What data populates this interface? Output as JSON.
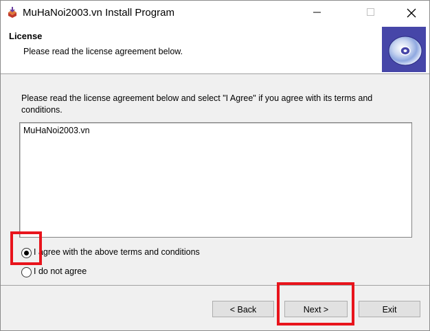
{
  "window": {
    "title": "MuHaNoi2003.vn Install Program",
    "icon": "installer-icon"
  },
  "header": {
    "title": "License",
    "subtitle": "Please read the license agreement below.",
    "badge_icon": "cd-disc-icon",
    "badge_color": "#4646a8"
  },
  "content": {
    "instructions": "Please read the license agreement below and select \"I Agree\" if you agree with its terms and conditions.",
    "license_text": "MuHaNoi2003.vn"
  },
  "options": {
    "agree_label": "I agree with the above terms and conditions",
    "disagree_label": "I do not agree",
    "selected": "agree"
  },
  "buttons": {
    "back_label": "< Back",
    "next_label": "Next >",
    "exit_label": "Exit"
  },
  "annotations": {
    "highlight_color": "#e8141c"
  }
}
